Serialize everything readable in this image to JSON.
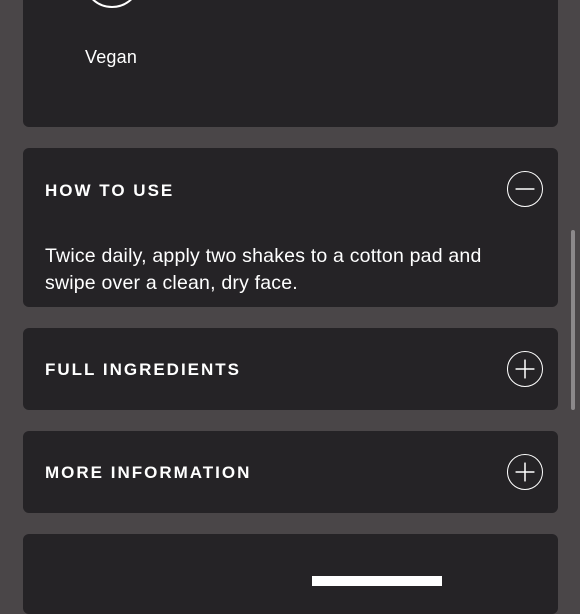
{
  "vegan_card": {
    "label": "Vegan",
    "badge_icon": "vegan-badge-icon"
  },
  "how_to_use": {
    "title": "HOW TO USE",
    "toggle_state": "expanded",
    "toggle_icon": "minus-icon",
    "body": "Twice daily, apply two shakes to a cotton pad and swipe over a clean, dry face."
  },
  "full_ingredients": {
    "title": "FULL INGREDIENTS",
    "toggle_state": "collapsed",
    "toggle_icon": "plus-icon"
  },
  "more_information": {
    "title": "MORE INFORMATION",
    "toggle_state": "collapsed",
    "toggle_icon": "plus-icon"
  },
  "colors": {
    "page_bg": "#4a4648",
    "card_bg": "#252326",
    "text": "#ffffff",
    "scrollbar": "#8c898b"
  }
}
